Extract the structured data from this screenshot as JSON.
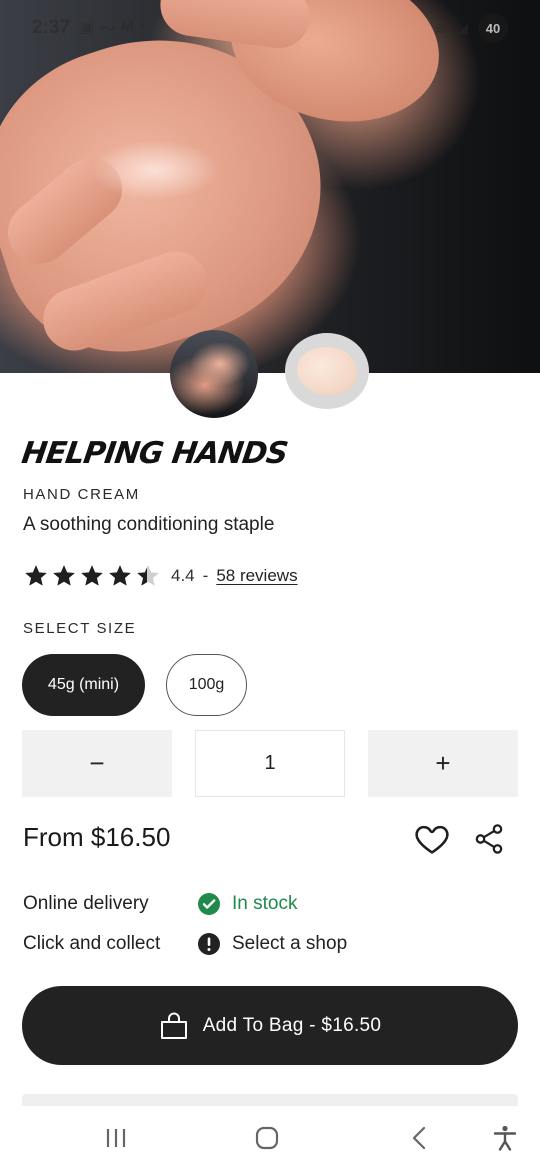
{
  "status_bar": {
    "time": "2:37",
    "notification_icons": [
      "screenshot-icon",
      "wave-icon",
      "gmail-icon",
      "dot-icon"
    ],
    "battery": "40"
  },
  "gallery": {
    "thumbnails": [
      {
        "name": "hand-photo",
        "selected": true
      },
      {
        "name": "cream-swatch",
        "selected": false
      }
    ]
  },
  "product": {
    "title": "HELPING HANDS",
    "category": "HAND CREAM",
    "tagline": "A soothing conditioning staple",
    "rating": {
      "value": "4.4",
      "separator": "-",
      "reviews_text": "58 reviews",
      "stars_filled": 4.4,
      "stars_total": 5
    }
  },
  "size": {
    "label": "SELECT SIZE",
    "options": [
      {
        "label": "45g (mini)",
        "selected": true
      },
      {
        "label": "100g",
        "selected": false
      }
    ]
  },
  "quantity": {
    "minus": "−",
    "value": "1",
    "plus": "+"
  },
  "price": {
    "text": "From $16.50"
  },
  "availability": [
    {
      "label": "Online delivery",
      "status": "In stock",
      "icon": "check-circle-icon",
      "color": "#1f8a4c"
    },
    {
      "label": "Click and collect",
      "status": "Select a shop",
      "icon": "alert-circle-icon",
      "color": "#222222"
    }
  ],
  "cta": {
    "label": "Add To Bag - $16.50",
    "icon": "shopping-bag-icon"
  },
  "system_nav": {
    "icons": [
      "recent-apps-icon",
      "home-icon",
      "back-icon",
      "accessibility-icon"
    ]
  },
  "colors": {
    "primary_dark": "#222222",
    "in_stock_green": "#1f8a4c",
    "neutral_bg": "#f1f1f1"
  }
}
